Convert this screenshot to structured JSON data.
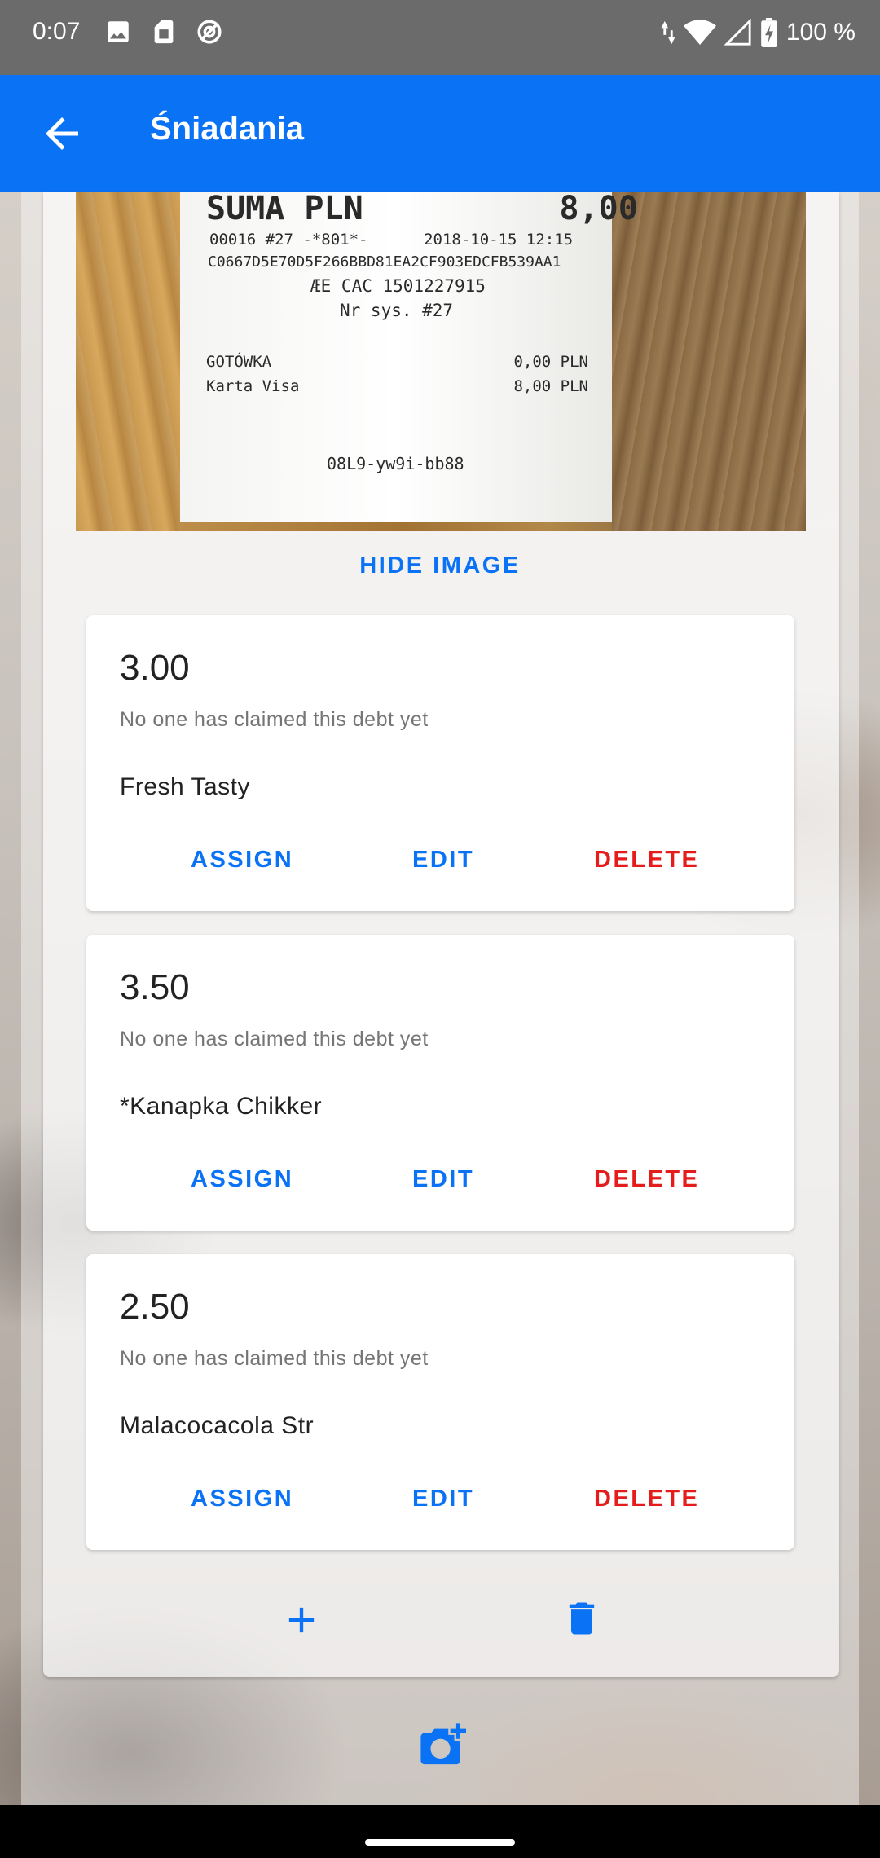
{
  "status_bar": {
    "time": "0:07",
    "battery": "100 %"
  },
  "app_bar": {
    "title": "Śniadania"
  },
  "receipt": {
    "lines": [
      "SUMA PLN          8,00",
      "00016 #27 -*801*-      2018-10-15 12:15",
      "C0667D5E70D5F266BBD81EA2CF903EDCFB539AA1",
      "ÆE CAC 1501227915",
      "Nr sys. #27",
      "GOTÓWKA                          0,00 PLN",
      "Karta Visa                       8,00 PLN",
      "08L9-yw9i-bb88"
    ]
  },
  "hide_image_label": "HIDE IMAGE",
  "debts": [
    {
      "amount": "3.00",
      "claim_status": "No one has claimed this debt yet",
      "name": "Fresh Tasty",
      "assign_label": "ASSIGN",
      "edit_label": "EDIT",
      "delete_label": "DELETE"
    },
    {
      "amount": "3.50",
      "claim_status": "No one has claimed this debt yet",
      "name": "*Kanapka Chikker",
      "assign_label": "ASSIGN",
      "edit_label": "EDIT",
      "delete_label": "DELETE"
    },
    {
      "amount": "2.50",
      "claim_status": "No one has claimed this debt yet",
      "name": "Malacocacola Str",
      "assign_label": "ASSIGN",
      "edit_label": "EDIT",
      "delete_label": "DELETE"
    }
  ],
  "icons": {
    "add": "add-icon",
    "delete_all": "trash-icon",
    "add_image": "add-photo-icon",
    "back": "arrow-back-icon"
  },
  "colors": {
    "primary": "#0a72f5",
    "danger": "#e51c1c",
    "status_bar": "#6b6b6b"
  }
}
